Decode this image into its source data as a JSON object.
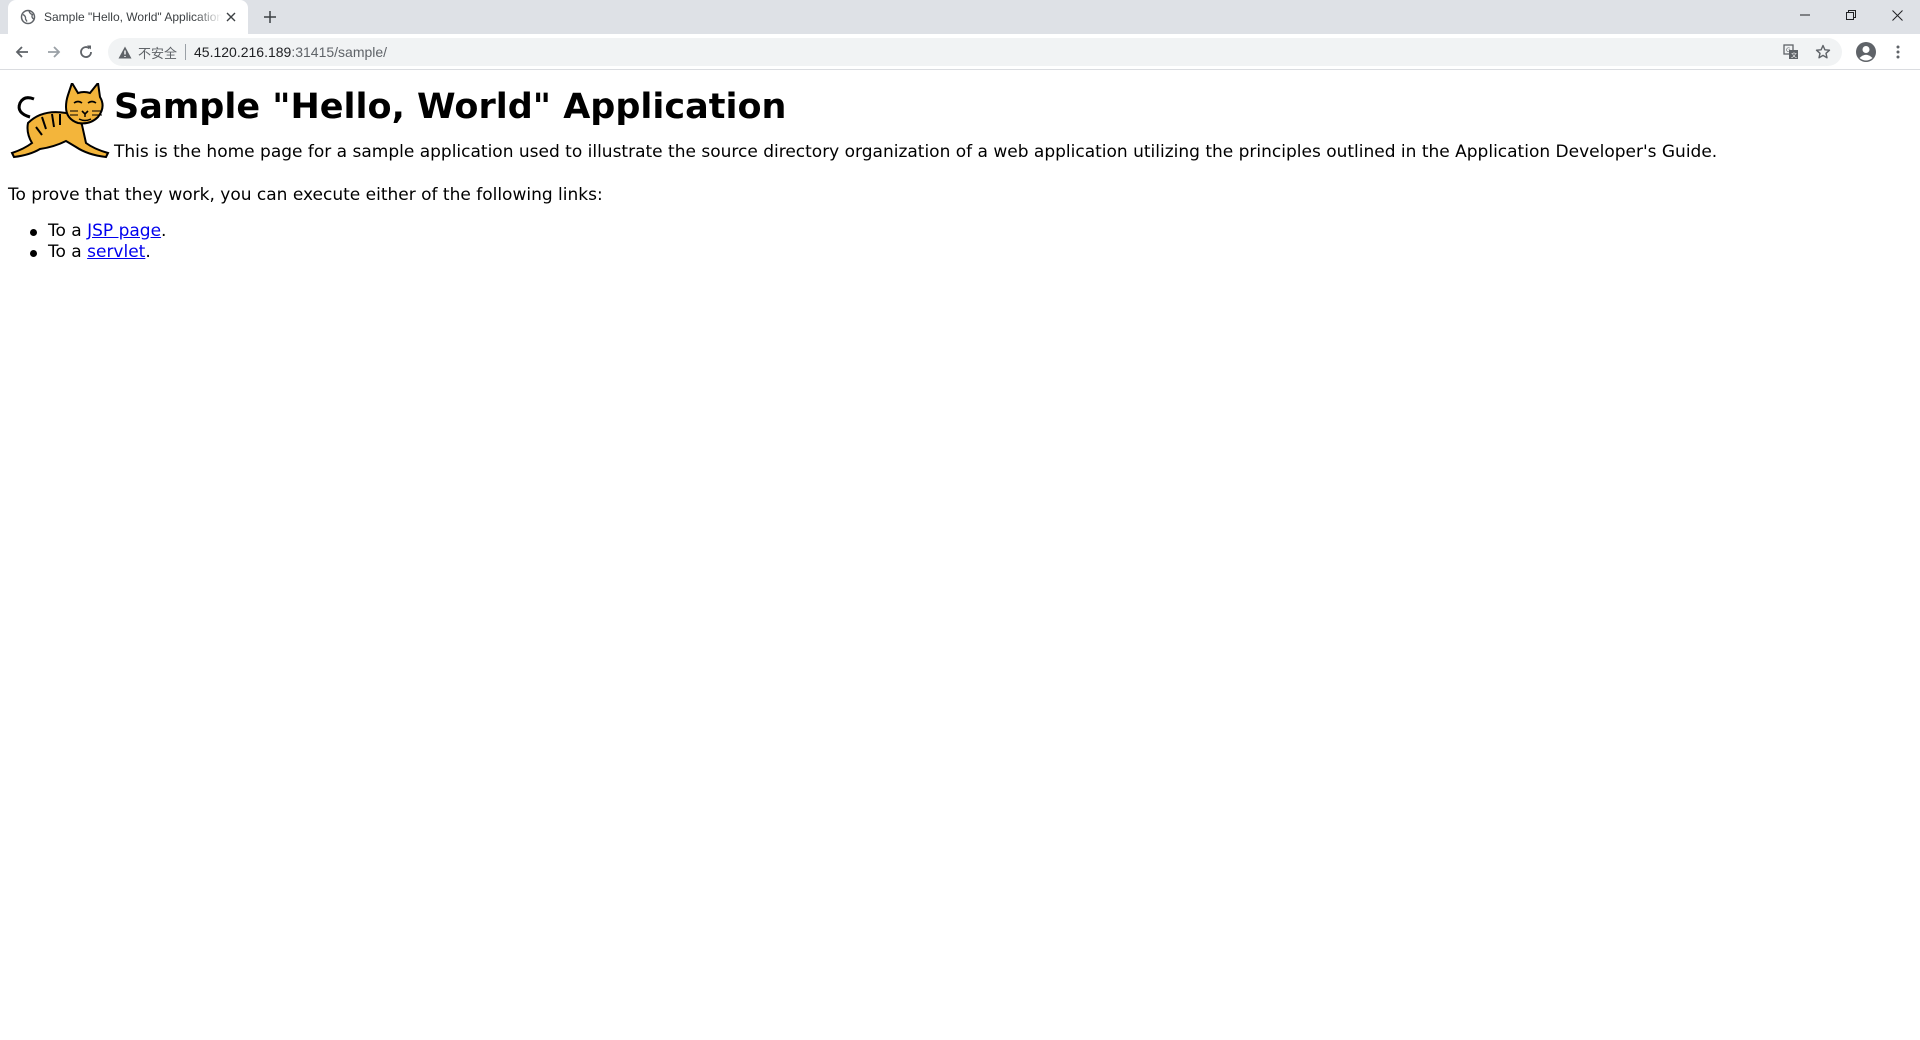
{
  "browser": {
    "tab": {
      "title": "Sample \"Hello, World\" Application"
    },
    "omnibox": {
      "security_label": "不安全",
      "url_host": "45.120.216.189",
      "url_rest": ":31415/sample/"
    },
    "icons": {
      "favicon": "globe-icon",
      "close_tab": "close-icon",
      "new_tab": "plus-icon",
      "minimize": "minimize-icon",
      "restore": "restore-icon",
      "close_window": "close-icon",
      "back": "back-arrow-icon",
      "forward": "forward-arrow-icon",
      "reload": "reload-icon",
      "warning": "warning-icon",
      "translate": "translate-icon",
      "bookmark": "star-icon",
      "profile": "profile-icon",
      "menu": "kebab-menu-icon"
    }
  },
  "page": {
    "title": "Sample \"Hello, World\" Application",
    "intro": "This is the home page for a sample application used to illustrate the source directory organization of a web application utilizing the principles outlined in the Application Developer's Guide.",
    "prove": "To prove that they work, you can execute either of the following links:",
    "links": [
      {
        "prefix": "To a ",
        "link": "JSP page",
        "suffix": "."
      },
      {
        "prefix": "To a ",
        "link": "servlet",
        "suffix": "."
      }
    ],
    "logo": "tomcat-logo"
  },
  "colors": {
    "tabstrip": "#dee1e6",
    "omnibox": "#f1f3f4",
    "link": "#0000ee",
    "logo_fur": "#f3b53b"
  }
}
